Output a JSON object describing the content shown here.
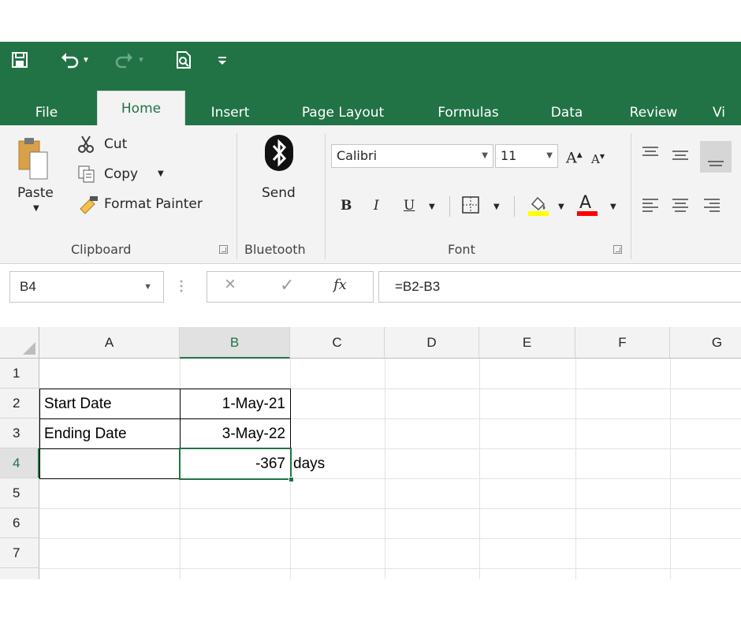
{
  "quick_access": {
    "save": "save-icon",
    "undo": "undo-icon",
    "redo": "redo-icon",
    "print_preview": "print-preview-icon",
    "customize": "customize-qat-icon"
  },
  "tabs": [
    {
      "label": "File"
    },
    {
      "label": "Home"
    },
    {
      "label": "Insert"
    },
    {
      "label": "Page Layout"
    },
    {
      "label": "Formulas"
    },
    {
      "label": "Data"
    },
    {
      "label": "Review"
    },
    {
      "label": "Vi"
    }
  ],
  "ribbon": {
    "clipboard": {
      "paste": "Paste",
      "cut": "Cut",
      "copy": "Copy",
      "format_painter": "Format Painter",
      "group_label": "Clipboard"
    },
    "bluetooth": {
      "send": "Send",
      "group_label": "Bluetooth"
    },
    "font": {
      "font_name": "Calibri",
      "font_size": "11",
      "bold": "B",
      "italic": "I",
      "underline": "U",
      "group_label": "Font"
    }
  },
  "formula_bar": {
    "name_box": "B4",
    "cancel": "×",
    "enter": "✓",
    "fx": "fx",
    "formula": "=B2-B3"
  },
  "sheet": {
    "columns": [
      "A",
      "B",
      "C",
      "D",
      "E",
      "F",
      "G"
    ],
    "rows": [
      "1",
      "2",
      "3",
      "4",
      "5",
      "6",
      "7"
    ],
    "cells": {
      "A2": "Start Date",
      "B2": "1-May-21",
      "A3": "Ending Date",
      "B3": "3-May-22",
      "B4": "-367",
      "C4": "days"
    }
  },
  "colors": {
    "accent": "#217346",
    "ribbon_bg": "#f3f3f3",
    "fill_yellow": "#ffff00",
    "font_red": "#ff0000"
  }
}
